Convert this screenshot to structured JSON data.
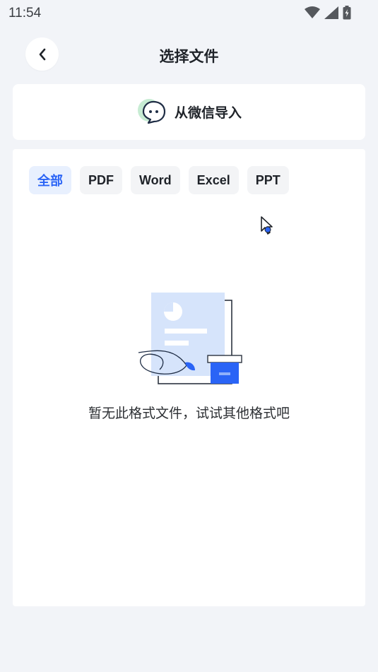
{
  "status_bar": {
    "time": "11:54",
    "icons": [
      "wifi-icon",
      "signal-icon",
      "battery-icon"
    ]
  },
  "header": {
    "title": "选择文件",
    "back_icon": "chevron-left-icon"
  },
  "wechat_import": {
    "label": "从微信导入",
    "icon": "wechat-icon"
  },
  "tabs": [
    {
      "label": "全部",
      "active": true
    },
    {
      "label": "PDF",
      "active": false
    },
    {
      "label": "Word",
      "active": false
    },
    {
      "label": "Excel",
      "active": false
    },
    {
      "label": "PPT",
      "active": false
    }
  ],
  "empty_state": {
    "message": "暂无此格式文件，试试其他格式吧",
    "illustration": "empty-document-illustration"
  },
  "colors": {
    "accent": "#2a64f6",
    "background": "#f2f4f8",
    "tab_active_bg": "#e8f0fe",
    "tab_bg": "#f3f4f6"
  }
}
